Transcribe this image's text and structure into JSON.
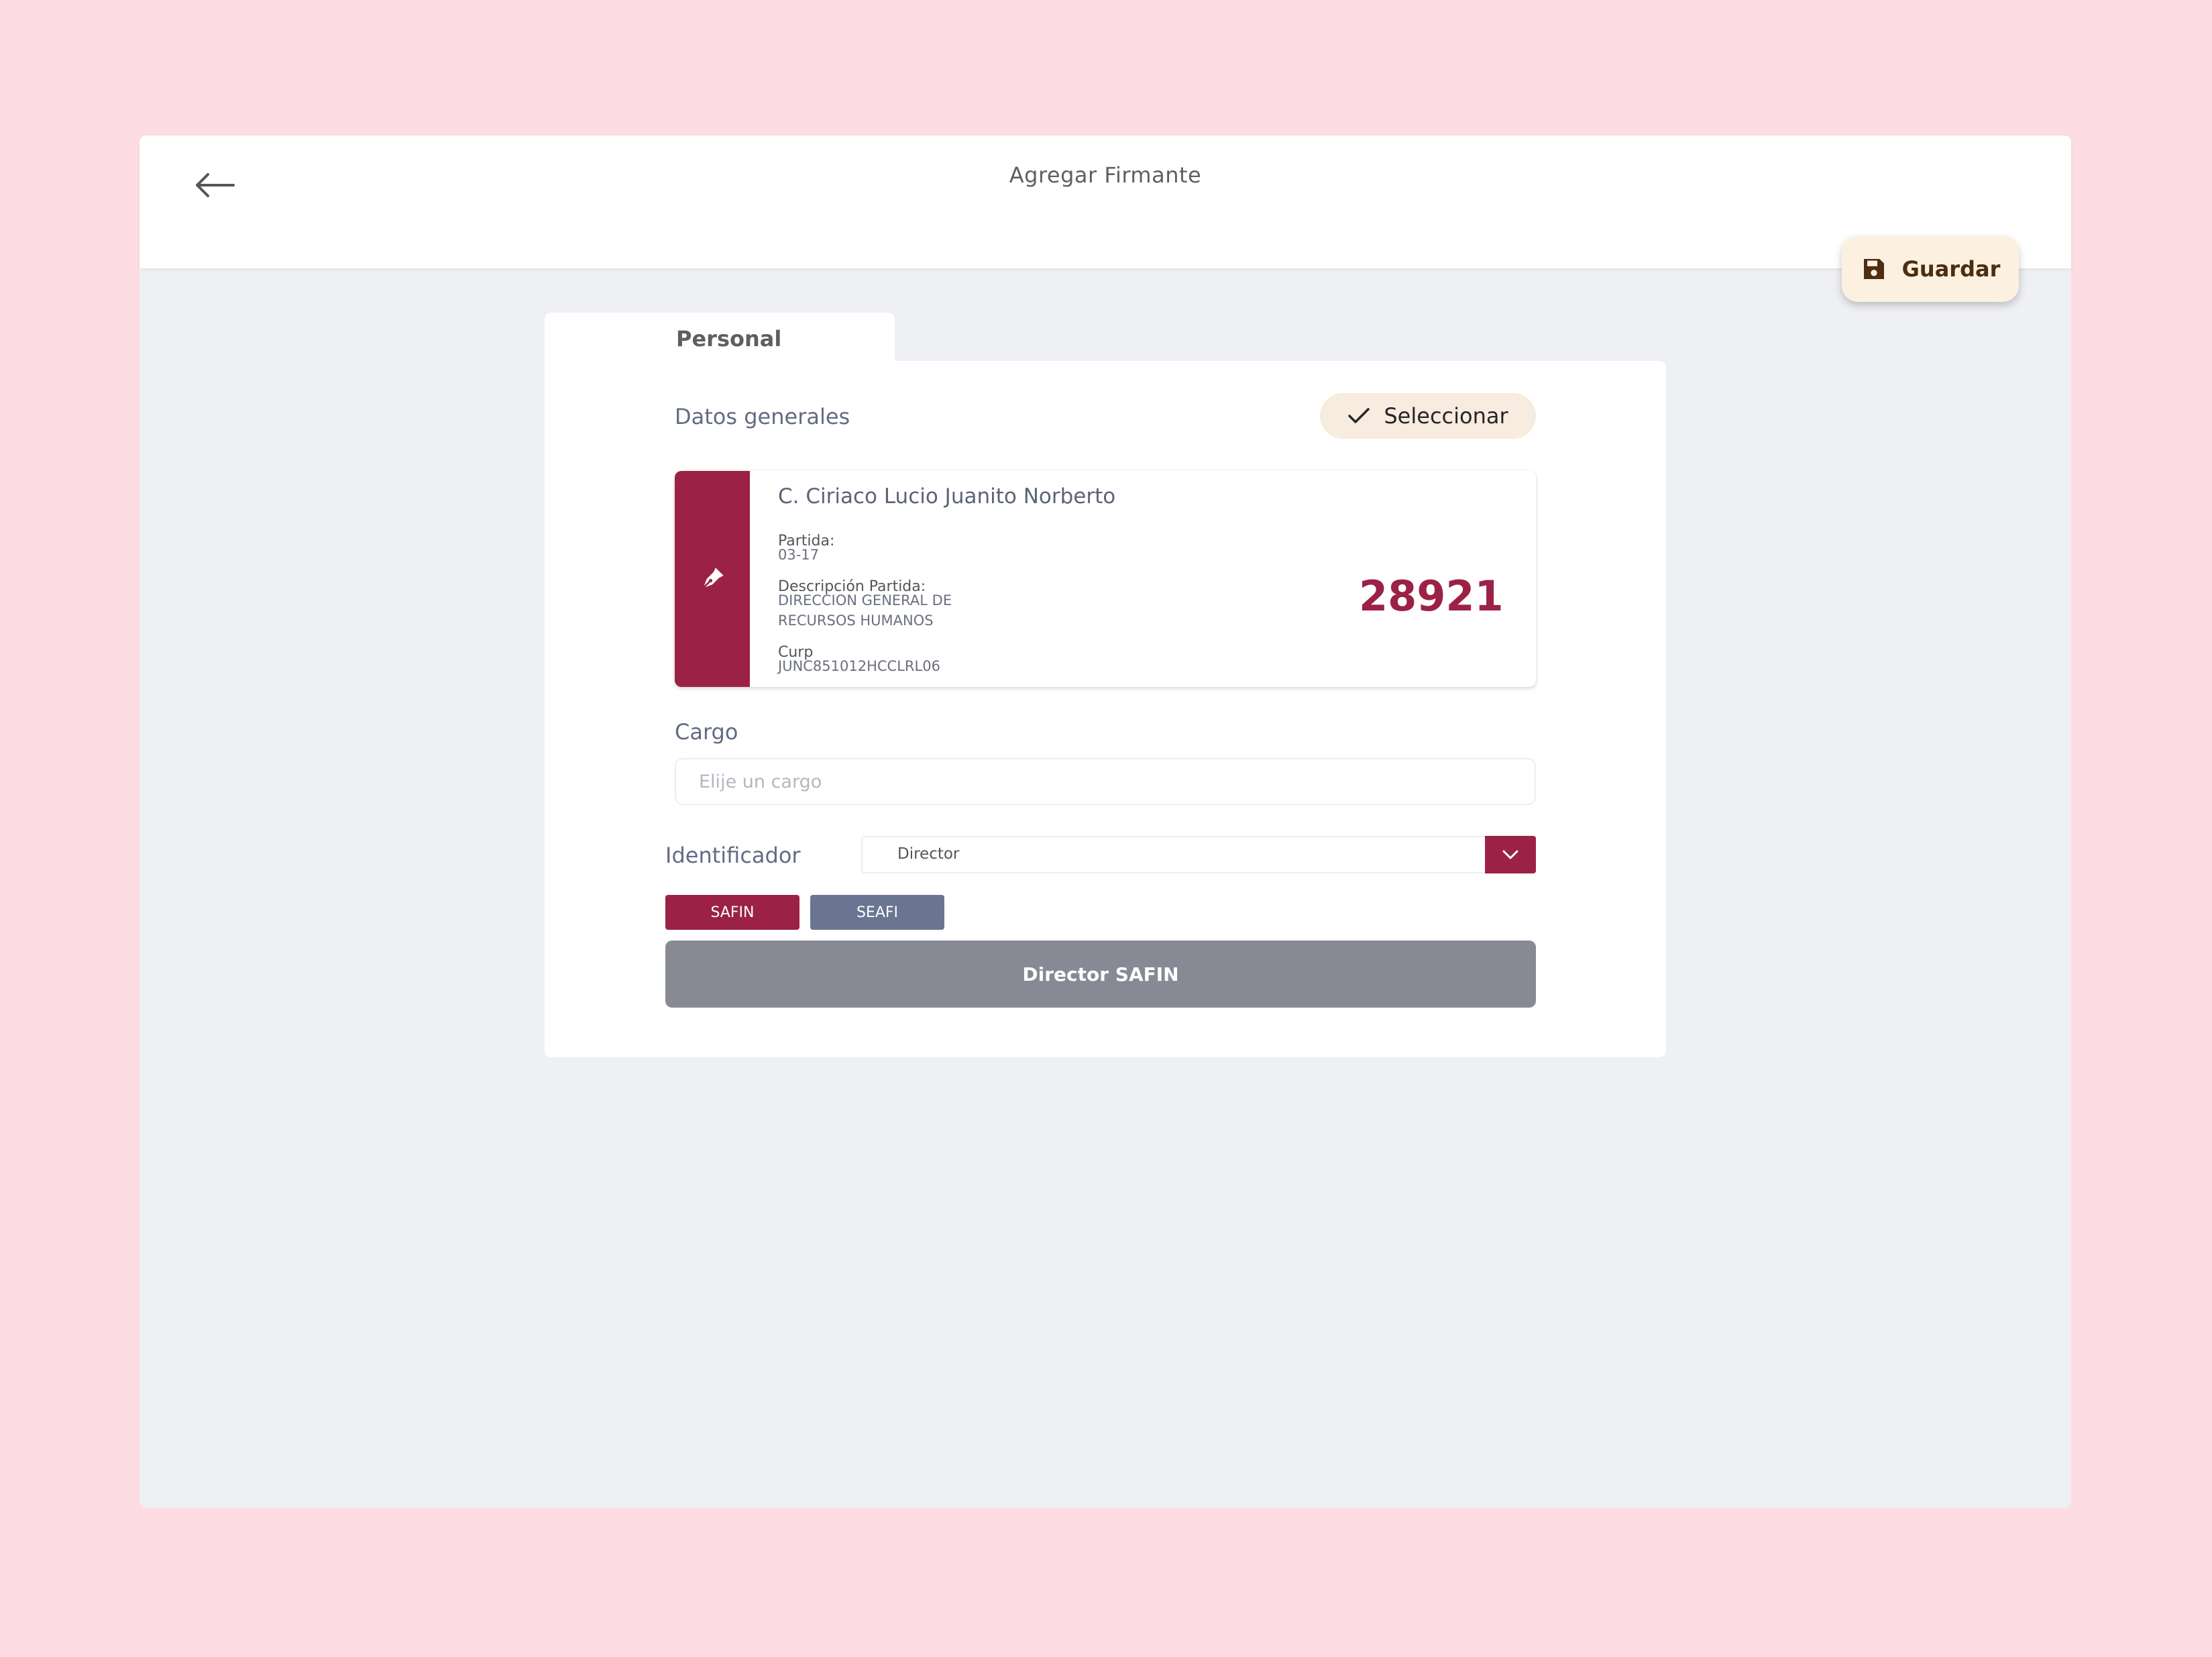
{
  "header": {
    "title": "Agregar Firmante",
    "back_icon": "arrow-left-icon",
    "save_label": "Guardar",
    "save_icon": "floppy-disk-icon"
  },
  "tabs": [
    {
      "label": "Personal",
      "active": true
    }
  ],
  "datos_generales": {
    "title": "Datos generales",
    "select_label": "Seleccionar",
    "select_icon": "checkmark-icon"
  },
  "person": {
    "icon": "fountain-pen-icon",
    "name": "C. Ciriaco Lucio Juanito Norberto",
    "partida_label": "Partida:",
    "partida_value": "03-17",
    "descripcion_label": "Descripción Partida:",
    "descripcion_value": "DIRECCION GENERAL DE RECURSOS HUMANOS",
    "curp_label": "Curp",
    "curp_value": "JUNC851012HCCLRL06",
    "number": "28921"
  },
  "cargo": {
    "label": "Cargo",
    "placeholder": "Elije un cargo",
    "value": ""
  },
  "identificador": {
    "label": "Identificador",
    "selected": "Director",
    "toggle_icon": "chevron-down-icon"
  },
  "chips": {
    "safin": "SAFIN",
    "seafi": "SEAFI"
  },
  "result_label": "Director SAFIN",
  "colors": {
    "background": "#fddce3",
    "brand": "#9b2246",
    "secondary_chip": "#6b7592",
    "result_button": "#878a94",
    "guardar_bg": "#fcf1e0",
    "select_bg": "#f8ebe0"
  }
}
